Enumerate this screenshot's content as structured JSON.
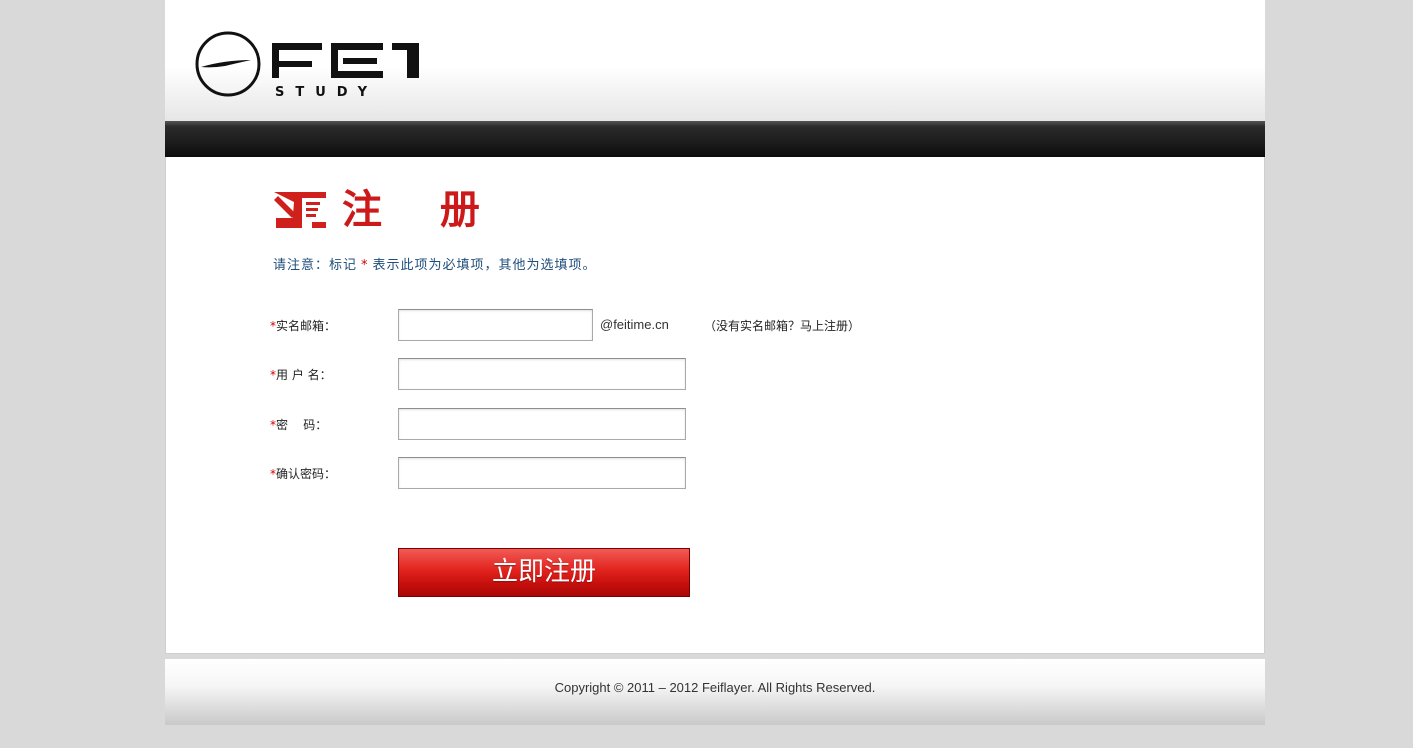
{
  "header": {
    "logo_text": "FEI",
    "logo_subtext": "STUDY"
  },
  "form": {
    "title": "注 册",
    "notice_before": "请注意：标记",
    "notice_star": "*",
    "notice_after": "表示此项为必填项，其他为选填项。",
    "fields": [
      {
        "required_mark": "*",
        "label": "实名邮箱：",
        "value": "",
        "suffix": "@feitime.cn",
        "hint": "（没有实名邮箱？马上注册）"
      },
      {
        "required_mark": "*",
        "label": "用 户 名：",
        "value": ""
      },
      {
        "required_mark": "*",
        "label": "密    码：",
        "value": ""
      },
      {
        "required_mark": "*",
        "label": "确认密码：",
        "value": ""
      }
    ],
    "submit_label": "立即注册"
  },
  "footer": {
    "copyright": "Copyright © 2011 – 2012 Feiflayer. All Rights Reserved."
  },
  "colors": {
    "accent_red": "#cc1a1a",
    "notice_blue": "#1f4e7a",
    "navbar": "#1c1c1c"
  }
}
